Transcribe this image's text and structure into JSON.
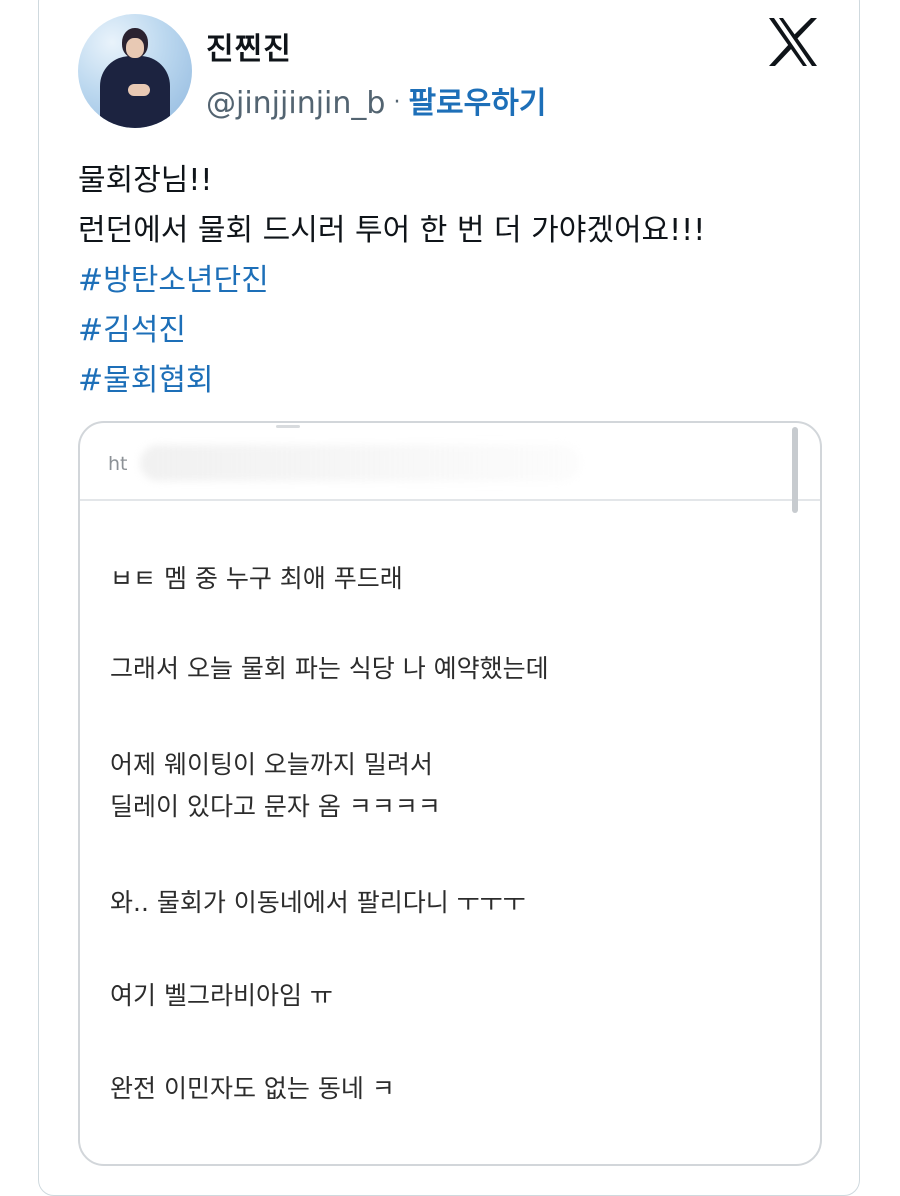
{
  "user": {
    "display_name": "진찐진",
    "handle": "@jinjjinjin_b",
    "separator": "·",
    "follow_label": "팔로우하기"
  },
  "icons": {
    "platform": "x-logo-icon",
    "avatar": "profile-photo"
  },
  "colors": {
    "link": "#1d6fb8",
    "secondary_text": "#536471",
    "border": "#cfd9de"
  },
  "tweet": {
    "lines": [
      "물회장님!!",
      "런던에서 물회 드시러 투어 한 번 더 가야겠어요!!!"
    ],
    "hashtags": [
      "#방탄소년단진",
      "#김석진",
      "#물회협회"
    ]
  },
  "embedded": {
    "url_fragment": "ht",
    "paragraphs": [
      [
        "ㅂㅌ 멤 중 누구 최애 푸드래"
      ],
      [
        "그래서 오늘 물회 파는 식당 나 예약했는데"
      ],
      [
        "어제 웨이팅이 오늘까지 밀려서",
        "딜레이 있다고 문자 옴 ㅋㅋㅋㅋ"
      ],
      [
        "와.. 물회가 이동네에서 팔리다니 ㅜㅜㅜ"
      ],
      [
        "여기 벨그라비아임 ㅠ"
      ],
      [
        "완전 이민자도 없는 동네 ㅋ"
      ]
    ]
  }
}
